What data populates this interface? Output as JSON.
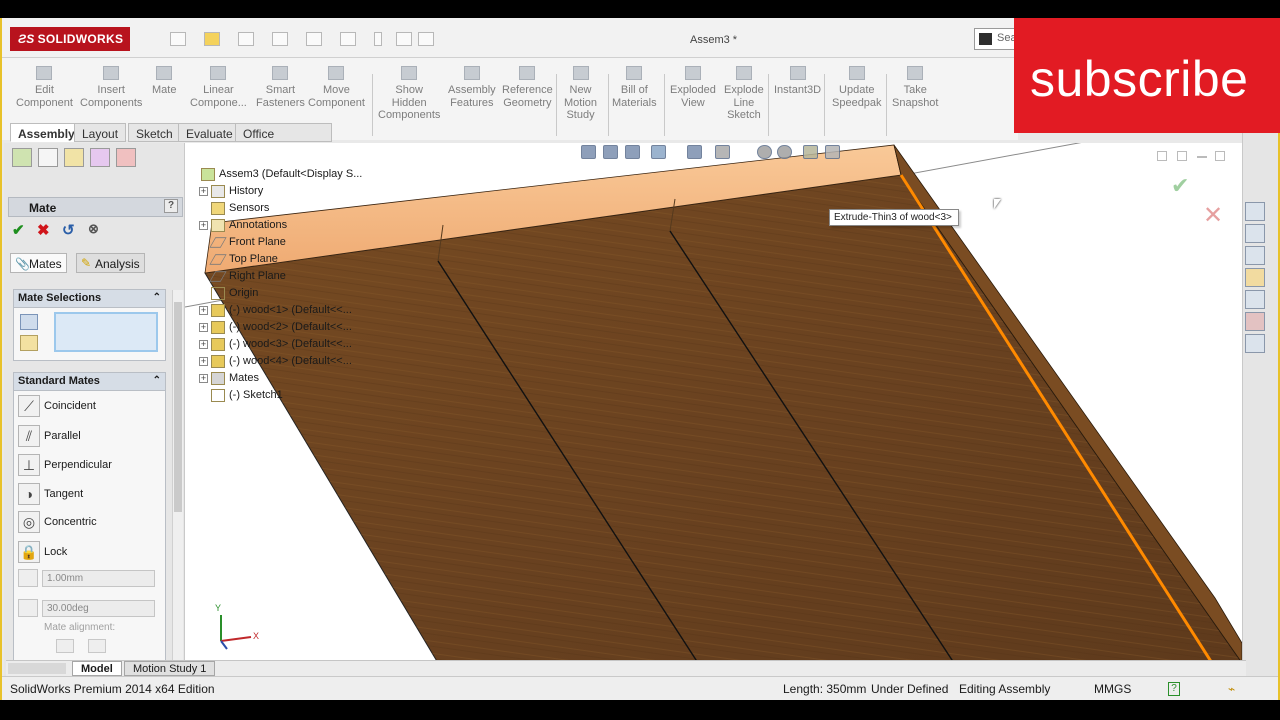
{
  "app": {
    "logo": "SOLIDWORKS",
    "document_title": "Assem3 *",
    "search_placeholder": "Sea"
  },
  "command_manager": [
    {
      "label": "Edit\nComponent",
      "icon": "edit-component-icon"
    },
    {
      "label": "Insert\nComponents",
      "icon": "insert-components-icon"
    },
    {
      "label": "Mate",
      "icon": "mate-icon"
    },
    {
      "label": "Linear\nCompone...",
      "icon": "linear-pattern-icon"
    },
    {
      "label": "Smart\nFasteners",
      "icon": "smart-fasteners-icon"
    },
    {
      "label": "Move\nComponent",
      "icon": "move-component-icon"
    },
    {
      "label": "Show\nHidden\nComponents",
      "icon": "show-hidden-icon"
    },
    {
      "label": "Assembly\nFeatures",
      "icon": "assembly-features-icon"
    },
    {
      "label": "Reference\nGeometry",
      "icon": "reference-geometry-icon"
    },
    {
      "label": "New\nMotion\nStudy",
      "icon": "motion-study-icon"
    },
    {
      "label": "Bill of\nMaterials",
      "icon": "bom-icon"
    },
    {
      "label": "Exploded\nView",
      "icon": "exploded-view-icon"
    },
    {
      "label": "Explode\nLine\nSketch",
      "icon": "explode-line-icon"
    },
    {
      "label": "Instant3D",
      "icon": "instant3d-icon"
    },
    {
      "label": "Update\nSpeedpak",
      "icon": "speedpak-icon"
    },
    {
      "label": "Take\nSnapshot",
      "icon": "snapshot-icon"
    }
  ],
  "tabs": [
    "Assembly",
    "Layout",
    "Sketch",
    "Evaluate",
    "Office Products"
  ],
  "property_manager": {
    "title": "Mate",
    "help": "?",
    "subtabs": [
      "Mates",
      "Analysis"
    ],
    "mate_selections_title": "Mate Selections",
    "standard_mates_title": "Standard Mates",
    "standard_mates": [
      "Coincident",
      "Parallel",
      "Perpendicular",
      "Tangent",
      "Concentric",
      "Lock"
    ],
    "distance_value": "1.00mm",
    "angle_value": "30.00deg",
    "mate_alignment": "Mate alignment:"
  },
  "feature_tree": [
    {
      "label": "Assem3  (Default<Display S...",
      "icon": "assembly-icon",
      "indent": 0,
      "expander": ""
    },
    {
      "label": "History",
      "icon": "history-icon",
      "indent": 1,
      "expander": "+"
    },
    {
      "label": "Sensors",
      "icon": "sensors-icon",
      "indent": 1,
      "expander": ""
    },
    {
      "label": "Annotations",
      "icon": "annotations-icon",
      "indent": 1,
      "expander": "+"
    },
    {
      "label": "Front Plane",
      "icon": "plane-icon",
      "indent": 1,
      "expander": ""
    },
    {
      "label": "Top Plane",
      "icon": "plane-icon",
      "indent": 1,
      "expander": ""
    },
    {
      "label": "Right Plane",
      "icon": "plane-icon",
      "indent": 1,
      "expander": ""
    },
    {
      "label": "Origin",
      "icon": "origin-icon",
      "indent": 1,
      "expander": ""
    },
    {
      "label": "(-) wood<1> (Default<<...",
      "icon": "part-icon",
      "indent": 1,
      "expander": "+"
    },
    {
      "label": "(-) wood<2> (Default<<...",
      "icon": "part-icon",
      "indent": 1,
      "expander": "+"
    },
    {
      "label": "(-) wood<3> (Default<<...",
      "icon": "part-icon",
      "indent": 1,
      "expander": "+"
    },
    {
      "label": "(-) wood<4> (Default<<...",
      "icon": "part-icon",
      "indent": 1,
      "expander": "+"
    },
    {
      "label": "Mates",
      "icon": "mates-folder-icon",
      "indent": 1,
      "expander": "+"
    },
    {
      "label": "(-) Sketch1",
      "icon": "sketch-icon",
      "indent": 1,
      "expander": ""
    }
  ],
  "tooltip": "Extrude-Thin3 of wood<3>",
  "triad": {
    "x": "X",
    "y": "Y"
  },
  "model_tabs": [
    "Model",
    "Motion Study 1"
  ],
  "status_bar": {
    "edition": "SolidWorks Premium 2014 x64 Edition",
    "length": "Length: 350mm",
    "state": "Under Defined",
    "mode": "Editing Assembly",
    "units": "MMGS",
    "help": "?"
  },
  "overlay": {
    "subscribe": "subscribe"
  },
  "colors": {
    "accent": "#b8131d",
    "highlight_edge": "#ff8a00",
    "wood": "#6e4521",
    "subscribe_bg": "#e21b23"
  }
}
